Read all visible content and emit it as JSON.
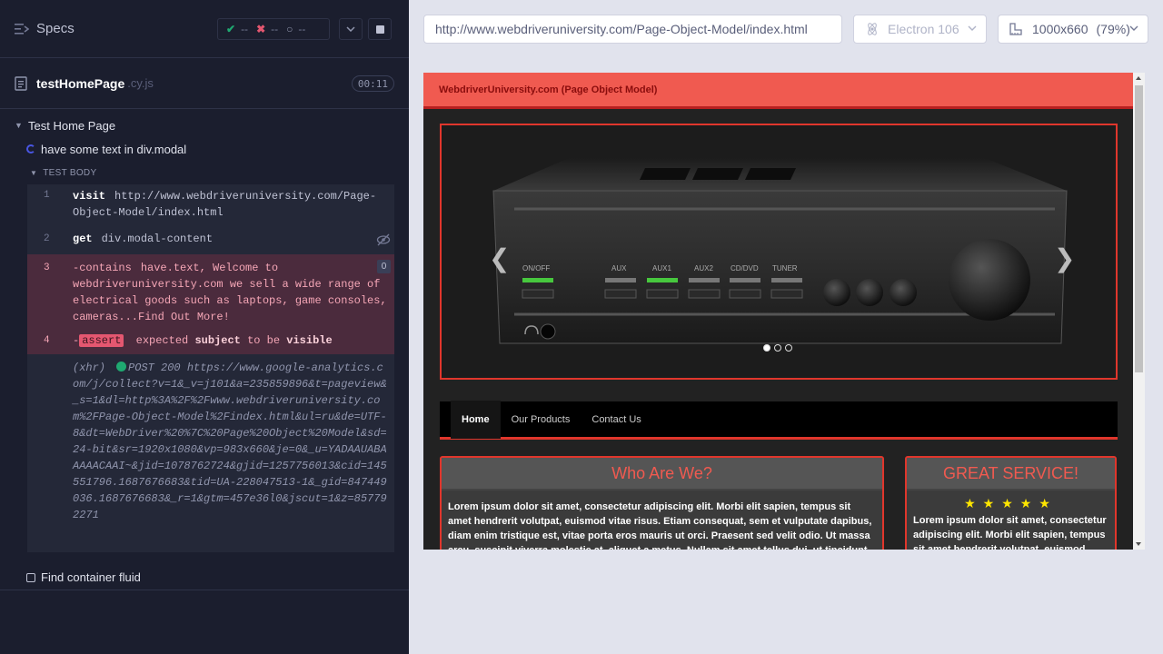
{
  "reporter": {
    "specs_label": "Specs",
    "stats": {
      "passed": "--",
      "failed": "--",
      "pending": "--"
    },
    "spec_file": {
      "name": "testHomePage",
      "ext": ".cy.js",
      "duration": "00:11"
    },
    "suite": {
      "title": "Test Home Page",
      "current_test": "have some text in div.modal",
      "body_label": "TEST BODY",
      "commands": [
        {
          "num": "1",
          "name": "visit",
          "message": "http://www.webdriveruniversity.com/Page-Object-Model/index.html"
        },
        {
          "num": "2",
          "name": "get",
          "message": "div.modal-content"
        },
        {
          "num": "3",
          "name": "-contains",
          "message": "have.text, Welcome to webdriveruniversity.com we sell a wide range of electrical goods such as laptops, game consoles, cameras...Find Out More!",
          "badge": "0"
        },
        {
          "num": "4",
          "prefix": "-",
          "tag": "assert",
          "words": [
            "expected",
            "subject",
            "to be",
            "visible"
          ]
        }
      ],
      "xhr": {
        "label": "(xhr)",
        "text": "POST 200 https://www.google-analytics.com/j/collect?v=1&_v=j101&a=235859896&t=pageview&_s=1&dl=http%3A%2F%2Fwww.webdriveruniversity.com%2FPage-Object-Model%2Findex.html&ul=ru&de=UTF-8&dt=WebDriver%20%7C%20Page%20Object%20Model&sd=24-bit&sr=1920x1080&vp=983x660&je=0&_u=YADAAUABAAAAACAAI~&jid=1078762724&gjid=1257756013&cid=145551796.1687676683&tid=UA-228047513-1&_gid=847449036.1687676683&_r=1&gtm=457e36l0&jscut=1&z=857792271"
      },
      "next_test": "Find container fluid"
    }
  },
  "toolbar": {
    "url": "http://www.webdriveruniversity.com/Page-Object-Model/index.html",
    "browser": "Electron 106",
    "viewport": "1000x660",
    "zoom": "(79%)"
  },
  "aut": {
    "banner": "WebdriverUniversity.com (Page Object Model)",
    "amp_labels": [
      "ON/OFF",
      "AUX",
      "AUX1",
      "AUX2",
      "CD/DVD",
      "TUNER"
    ],
    "nav": [
      "Home",
      "Our Products",
      "Contact Us"
    ],
    "panel_left": {
      "title": "Who Are We?",
      "text": "Lorem ipsum dolor sit amet, consectetur adipiscing elit. Morbi elit sapien, tempus sit amet hendrerit volutpat, euismod vitae risus. Etiam consequat, sem et vulputate dapibus, diam enim tristique est, vitae porta eros mauris ut orci. Praesent sed velit odio. Ut massa arcu, suscipit viverra molestie at, aliquet a metus. Nullam sit amet tellus dui, ut tincidunt justo. Lorem ipsum"
    },
    "panel_right": {
      "title": "GREAT SERVICE!",
      "stars": "★★★★★",
      "text": "Lorem ipsum dolor sit amet, consectetur adipiscing elit. Morbi elit sapien, tempus sit amet hendrerit volutpat, euismod vitae"
    }
  },
  "colors": {
    "accent_red": "#e0362c",
    "banner": "#f05a50",
    "pass": "#1fa971",
    "fail": "#e45770"
  }
}
